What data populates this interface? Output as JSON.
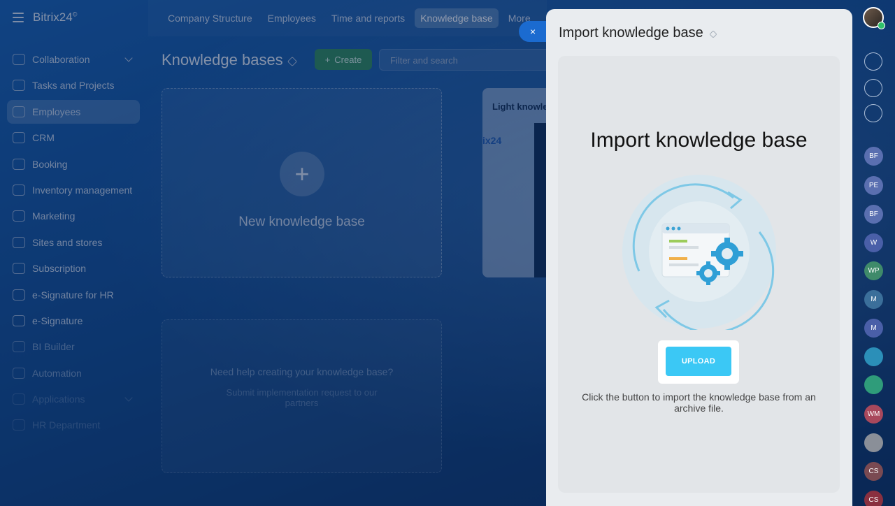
{
  "app": {
    "logo": "Bitrix24",
    "logo_mark": "©"
  },
  "topnav": [
    "Company Structure",
    "Employees",
    "Time and reports",
    "Knowledge base",
    "More"
  ],
  "sidebar": {
    "items": [
      {
        "label": "Collaboration",
        "icon": "chat-bubbles-icon"
      },
      {
        "label": "Tasks and Projects",
        "icon": "checkbox-icon"
      },
      {
        "label": "Employees",
        "icon": "id-card-icon"
      },
      {
        "label": "CRM",
        "icon": "funnel-icon"
      },
      {
        "label": "Booking",
        "icon": "calendar-icon"
      },
      {
        "label": "Inventory management",
        "icon": "box-icon"
      },
      {
        "label": "Marketing",
        "icon": "target-icon"
      },
      {
        "label": "Sites and stores",
        "icon": "cart-icon"
      },
      {
        "label": "Subscription",
        "icon": "refresh-icon"
      },
      {
        "label": "e-Signature for HR",
        "icon": "document-icon"
      },
      {
        "label": "e-Signature",
        "icon": "pen-icon"
      },
      {
        "label": "BI Builder",
        "icon": "bar-chart-icon"
      },
      {
        "label": "Automation",
        "icon": "flow-icon"
      },
      {
        "label": "Applications",
        "icon": "grid-icon"
      },
      {
        "label": "HR Department",
        "icon": "people-icon"
      }
    ]
  },
  "main": {
    "title": "Knowledge bases",
    "create_label": "Create",
    "filter_placeholder": "Filter and search",
    "new_card_label": "New knowledge base",
    "light_card_title": "Light knowle",
    "light_card_logo": "ix24",
    "help_title": "Need help creating your knowledge base?",
    "help_text": "Submit implementation request to our partners"
  },
  "close_label": "×",
  "panel": {
    "title": "Import knowledge base",
    "inner_title": "Import knowledge base",
    "upload_label": "UPLOAD",
    "hint": "Click the button to import the knowledge base from an archive file."
  },
  "rightbar": {
    "avatars": [
      "BF",
      "PE",
      "BF",
      "W",
      "WP",
      "M",
      "M",
      "",
      "",
      "WM",
      "",
      "CS",
      "CS"
    ]
  },
  "colors": {
    "accent": "#3bc8f5",
    "create_green": "#2e8a5a",
    "panel_bg": "#e9ecef"
  }
}
